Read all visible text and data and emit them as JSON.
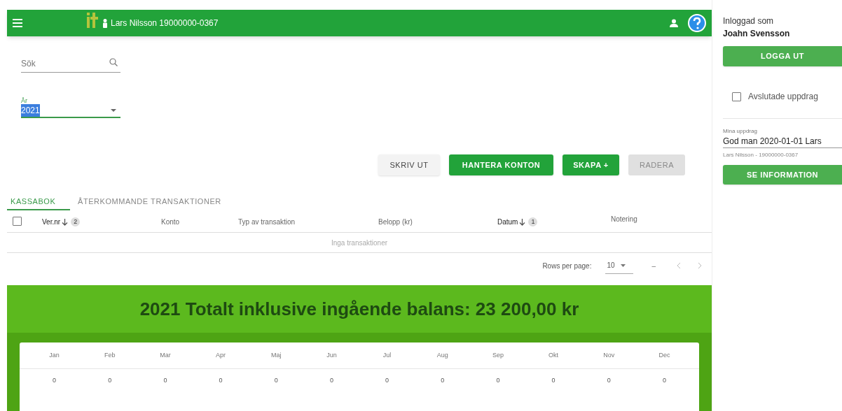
{
  "header": {
    "client": "Lars Nilsson 19000000-0367"
  },
  "search": {
    "placeholder": "Sök"
  },
  "year_select": {
    "label": "År",
    "value": "2021"
  },
  "buttons": [
    {
      "label": "SKRIV UT",
      "kind": "plain",
      "disabled": false
    },
    {
      "label": "HANTERA KONTON",
      "kind": "primary",
      "disabled": false
    },
    {
      "label": "SKAPA +",
      "kind": "primary",
      "disabled": false
    },
    {
      "label": "RADERA",
      "kind": "primary",
      "disabled": true
    }
  ],
  "tabs": [
    {
      "label": "KASSABOK",
      "selected": true
    },
    {
      "label": "ÅTERKOMMANDE TRANSAKTIONER",
      "selected": false
    }
  ],
  "table": {
    "select_all_checked": false,
    "columns": [
      {
        "label": "Ver.nr",
        "sort_order": "2"
      },
      {
        "label": "Konto"
      },
      {
        "label": "Typ av transaktion"
      },
      {
        "label": "Belopp (kr)"
      },
      {
        "label": "Datum",
        "sort_order": "1"
      },
      {
        "label": "Notering"
      }
    ],
    "empty_text": "Inga transaktioner"
  },
  "pagination": {
    "rows_per_page_label": "Rows per page:",
    "rows_per_page": "10",
    "range": "–"
  },
  "summary": {
    "title": "2021 Totalt inklusive ingående balans: 23 200,00 kr",
    "months": [
      "Jan",
      "Feb",
      "Mar",
      "Apr",
      "Maj",
      "Jun",
      "Jul",
      "Aug",
      "Sep",
      "Okt",
      "Nov",
      "Dec"
    ],
    "values": [
      "0",
      "0",
      "0",
      "0",
      "0",
      "0",
      "0",
      "0",
      "0",
      "0",
      "0",
      "0"
    ]
  },
  "sidebar": {
    "logged_in_label": "Inloggad som",
    "user": "Joahn Svensson",
    "logout": "LOGGA UT",
    "finished_checkbox": {
      "label": "Avslutade uppdrag",
      "checked": false
    },
    "assignment_select": {
      "label": "Mina uppdrag",
      "value": "God man 2020-01-01 Lars",
      "helper": "Lars Nilsson - 19000000-0367"
    },
    "info_button": "SE INFORMATION"
  }
}
